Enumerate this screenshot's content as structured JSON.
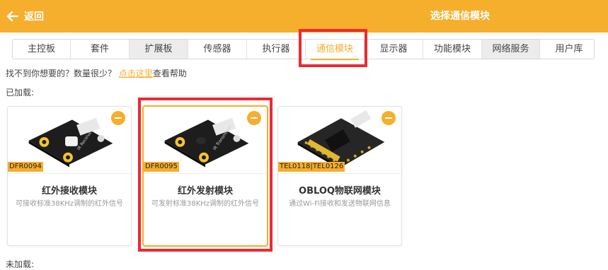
{
  "header": {
    "back_label": "返回",
    "title": "选择通信模块",
    "bg_color": "#f6ae2d"
  },
  "tabs": [
    {
      "label": "主控板",
      "state": "normal"
    },
    {
      "label": "套件",
      "state": "normal"
    },
    {
      "label": "扩展板",
      "state": "grey"
    },
    {
      "label": "传感器",
      "state": "normal"
    },
    {
      "label": "执行器",
      "state": "normal"
    },
    {
      "label": "通信模块",
      "state": "active"
    },
    {
      "label": "显示器",
      "state": "normal"
    },
    {
      "label": "功能模块",
      "state": "normal"
    },
    {
      "label": "网络服务",
      "state": "grey"
    },
    {
      "label": "用户库",
      "state": "normal"
    }
  ],
  "help": {
    "prefix": "找不到你想要的？数量很少？",
    "link": "点击这里",
    "suffix": "查看帮助"
  },
  "loaded_label": "已加载:",
  "cards": [
    {
      "sku": "DFR0094",
      "title": "红外接收模块",
      "desc": "可接收标准38KHz调制的红外信号",
      "selected": false,
      "image_icon": "ir-receiver-module-icon"
    },
    {
      "sku": "DFR0095",
      "title": "红外发射模块",
      "desc": "可发射标准38KHz调制的红外信号",
      "selected": true,
      "image_icon": "ir-transmitter-module-icon"
    },
    {
      "sku": "TEL0118|TEL0126",
      "title": "OBLOQ物联网模块",
      "desc": "通过Wi-Fi接收和发送物联网信息",
      "selected": false,
      "image_icon": "obloq-iot-module-icon"
    }
  ],
  "bottom_label": "未加载:",
  "colors": {
    "accent": "#f6ae2d",
    "highlight": "#ec2a32"
  }
}
